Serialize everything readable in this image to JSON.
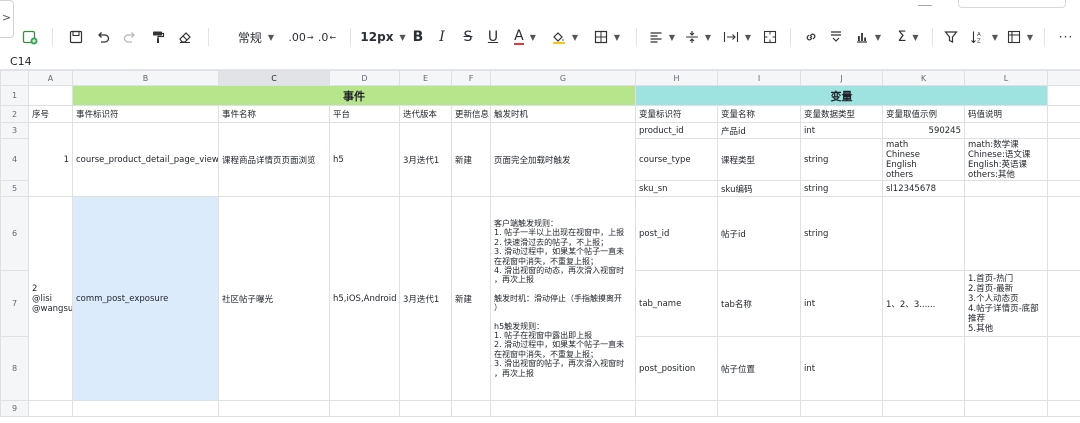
{
  "toolbar": {
    "format_label": "常规",
    "decimal_inc": ".00",
    "decimal_dec": ".0",
    "font_size": "12px",
    "bold": "B",
    "italic": "I",
    "strike": "S",
    "underline": "U",
    "text_color": "A",
    "more": "···"
  },
  "namebox": {
    "cell": "C14"
  },
  "columns": [
    "A",
    "B",
    "C",
    "D",
    "E",
    "F",
    "G",
    "H",
    "I",
    "J",
    "K",
    "L"
  ],
  "rows": [
    "1",
    "2",
    "3",
    "4",
    "5",
    "6",
    "7",
    "8",
    "9"
  ],
  "groups": {
    "event": "事件",
    "variable": "变量"
  },
  "headers": {
    "seq": "序号",
    "event_id": "事件标识符",
    "event_name": "事件名称",
    "platform": "平台",
    "version": "迭代版本",
    "update": "更新信息",
    "trigger": "触发时机",
    "var_id": "变量标识符",
    "var_name": "变量名称",
    "var_type": "变量数据类型",
    "var_example": "变量取值示例",
    "code_desc": "码值说明"
  },
  "event1": {
    "seq": "1",
    "id": "course_product_detail_page_view",
    "name": "课程商品详情页页面浏览",
    "platform": "h5",
    "version": "3月迭代1",
    "update": "新建",
    "trigger": "页面完全加载时触发",
    "vars": [
      {
        "id": "product_id",
        "name": "产品id",
        "type": "int",
        "example": "590245",
        "code": ""
      },
      {
        "id": "course_type",
        "name": "课程类型",
        "type": "string",
        "example_lines": [
          "math",
          "Chinese",
          "English",
          "others"
        ],
        "code_lines": [
          "math:数学课",
          "Chinese:语文课",
          "English:英语课",
          "others:其他"
        ]
      },
      {
        "id": "sku_sn",
        "name": "sku编码",
        "type": "string",
        "example": "sl12345678",
        "code": ""
      }
    ]
  },
  "event2": {
    "seq_lines": [
      "2",
      "@lisi",
      "@wangsu"
    ],
    "id": "comm_post_exposure",
    "name": "社区帖子曝光",
    "platform": "h5,iOS,Android",
    "version": "3月迭代1",
    "update": "新建",
    "trigger_lines": [
      "客户端触发规则：",
      "1. 帖子一半以上出现在视窗中，上报",
      "2. 快速滑过去的帖子，不上报；",
      "3. 滑动过程中，如果某个帖子一直未",
      "在视窗中消失，不重复上报；",
      "4. 滑出视窗的动态，再次滑入视窗时",
      "，再次上报",
      "",
      "触发时机：滑动停止（手指触摸离开",
      "）",
      "",
      "h5触发规则：",
      "1. 帖子在视窗中露出即上报",
      "2. 滑动过程中，如果某个帖子一直未",
      "在视窗中消失，不重复上报；",
      "3. 滑出视窗的帖子，再次滑入视窗时",
      "，再次上报"
    ],
    "vars": [
      {
        "id": "post_id",
        "name": "帖子id",
        "type": "string",
        "example": "",
        "code": ""
      },
      {
        "id": "tab_name",
        "name": "tab名称",
        "type": "int",
        "example": "1、2、3......",
        "code_lines": [
          "1.首页-热门",
          "2.首页-最新",
          "3.个人动态页",
          "4.帖子详情页-底部",
          "推荐",
          "5.其他"
        ]
      },
      {
        "id": "post_position",
        "name": "帖子位置",
        "type": "int",
        "example": "",
        "code": ""
      }
    ]
  },
  "colors": {
    "event_header": "#b6e58c",
    "variable_header": "#9fe3e0",
    "selected_cell": "#dcebfb"
  }
}
